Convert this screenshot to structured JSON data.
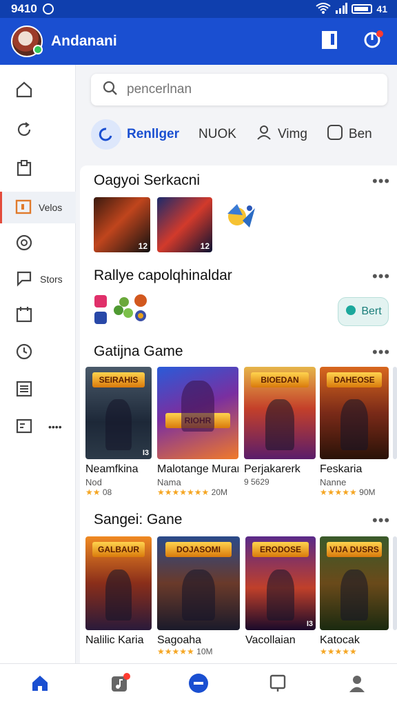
{
  "status": {
    "time": "9410",
    "battery": "41"
  },
  "appbar": {
    "title": "Andanani"
  },
  "sidebar": {
    "items": [
      {
        "label": "",
        "icon": "home-icon"
      },
      {
        "label": "",
        "icon": "refresh-icon"
      },
      {
        "label": "",
        "icon": "clipboard-icon"
      },
      {
        "label": "Velos",
        "icon": "square-icon",
        "active": true
      },
      {
        "label": "",
        "icon": "chat-icon"
      },
      {
        "label": "Stors",
        "icon": "flag-icon"
      },
      {
        "label": "",
        "icon": "calendar-icon"
      },
      {
        "label": "",
        "icon": "clock-icon"
      },
      {
        "label": "",
        "icon": "list-icon"
      },
      {
        "label": "••••",
        "icon": "card-icon"
      }
    ]
  },
  "search": {
    "placeholder": "pencerlnan"
  },
  "chips": [
    {
      "label": "Renllger",
      "active": true
    },
    {
      "label": "NUOK"
    },
    {
      "label": "Vimg"
    },
    {
      "label": "Ben"
    }
  ],
  "sections": {
    "s1": {
      "title": "Oagyoi Serkacni"
    },
    "s2": {
      "title": "Rallye capolqhinaldar",
      "button": "Bert"
    },
    "s3": {
      "title": "Gatijna Game"
    },
    "s4": {
      "title": "Sangei: Gane"
    }
  },
  "s1_tiles": [
    {
      "label": "12"
    },
    {
      "label": "12"
    }
  ],
  "games_row1": [
    {
      "name": "Neamfkina",
      "sub": "Nod",
      "stars": "★★",
      "rating": "08",
      "art_label": "I3",
      "logo": "SEIRAHIS"
    },
    {
      "name": "Malotange Murar",
      "sub": "Nama",
      "stars": "★★★★★★★",
      "rating": "20M",
      "art_label": "",
      "logo": "RIOHR"
    },
    {
      "name": "Perjakarerk",
      "sub": "",
      "stars": "",
      "rating": "9 5629",
      "art_label": "",
      "logo": "BIOEDAN"
    },
    {
      "name": "Feskaria",
      "sub": "Nanne",
      "stars": "★★★★★",
      "rating": "90M",
      "art_label": "",
      "logo": "DAHEOSE"
    }
  ],
  "games_row2": [
    {
      "name": "Nalilic Karia",
      "sub": "",
      "stars": "",
      "rating": "",
      "art_label": "",
      "logo": "GALBAUR"
    },
    {
      "name": "Sagoaha",
      "sub": "",
      "stars": "★★★★★",
      "rating": "10M",
      "art_label": "",
      "logo": "DOJASOMI"
    },
    {
      "name": "Vacollaian",
      "sub": "",
      "stars": "",
      "rating": "",
      "art_label": "I3",
      "logo": "ERODOSE"
    },
    {
      "name": "Katocak",
      "sub": "",
      "stars": "★★★★★",
      "rating": "",
      "art_label": "",
      "logo": "VIJA DUSRS"
    }
  ]
}
